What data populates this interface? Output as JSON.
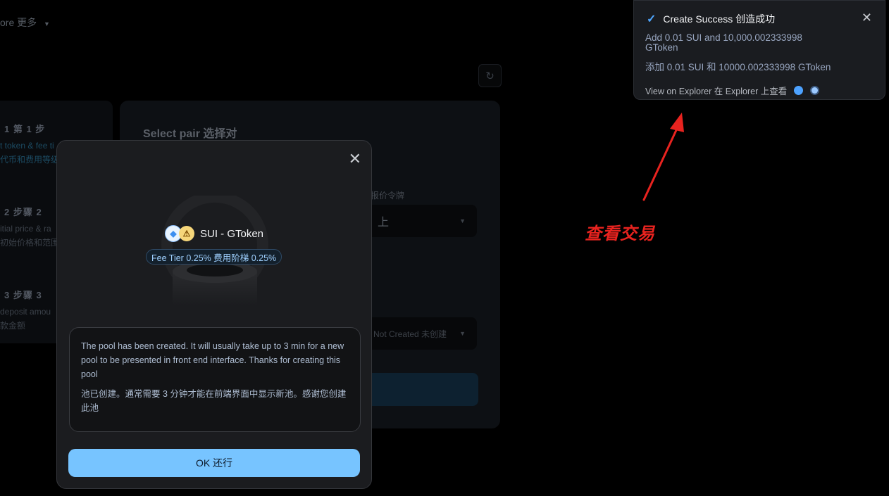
{
  "background": {
    "nav": {
      "more_label": "ore  更多"
    },
    "steps": [
      {
        "title": "1 第 1 步",
        "sub1": "t token & fee ti",
        "sub2": "代币和费用等级"
      },
      {
        "title": "2 步骤 2",
        "sub1": "itial price & ra",
        "sub2": "初始价格和范围"
      },
      {
        "title": "3 步骤 3",
        "sub1": "deposit amou",
        "sub2": "款金额"
      }
    ],
    "panel_title": "Select pair  选择对",
    "quote_label": "报价令牌",
    "quote_value": "上",
    "fee_value": "Not Created  未创建"
  },
  "toast": {
    "title": "Create Success  创造成功",
    "line_en": "Add 0.01 SUI and 10,000.002333998 GToken",
    "line_zh": "添加 0.01 SUI 和 10000.002333998 GToken",
    "explorer_link": "View on Explorer  在 Explorer 上查看",
    "close_glyph": "✕",
    "check_glyph": "✓"
  },
  "annotation": {
    "label": "查看交易",
    "color": "#e8231f"
  },
  "modal": {
    "close_glyph": "✕",
    "pair": "SUI - GToken",
    "token_a_icon": "sui-token-icon",
    "token_b_icon": "gtoken-warning-icon",
    "fee_tier": "Fee Tier 0.25%  费用阶梯 0.25%",
    "message_en": "The pool has been created. It will usually take up to 3 min for a new pool to be presented in front end interface. Thanks for creating this pool",
    "message_zh": "池已创建。通常需要 3 分钟才能在前端界面中显示新池。感谢您创建此池",
    "ok_label": "OK  还行"
  },
  "colors": {
    "accent": "#77c4ff",
    "toast_check": "#4fa7ff",
    "annotation": "#e8231f"
  }
}
